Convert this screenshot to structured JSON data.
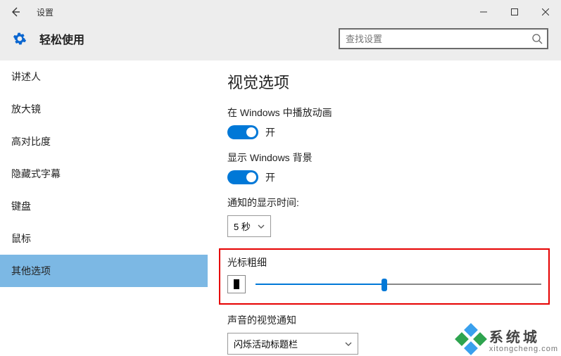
{
  "titlebar": {
    "title": "设置"
  },
  "header": {
    "category": "轻松使用",
    "search_placeholder": "查找设置"
  },
  "sidebar": {
    "items": [
      {
        "label": "讲述人"
      },
      {
        "label": "放大镜"
      },
      {
        "label": "高对比度"
      },
      {
        "label": "隐藏式字幕"
      },
      {
        "label": "键盘"
      },
      {
        "label": "鼠标"
      },
      {
        "label": "其他选项"
      }
    ],
    "selected_index": 6
  },
  "content": {
    "heading": "视觉选项",
    "play_animations": {
      "label": "在 Windows 中播放动画",
      "state": "开",
      "on": true
    },
    "show_background": {
      "label": "显示 Windows 背景",
      "state": "开",
      "on": true
    },
    "notification_duration": {
      "label": "通知的显示时间:",
      "value": "5 秒"
    },
    "cursor_thickness": {
      "label": "光标粗细",
      "percent": 45
    },
    "sound_visual": {
      "label": "声音的视觉通知",
      "value": "闪烁活动标题栏"
    }
  },
  "watermark": {
    "brand": "系统城",
    "domain": "xitongcheng.com"
  },
  "colors": {
    "accent": "#0078d7",
    "highlight": "#e60000",
    "sel": "#7cb8e4"
  }
}
